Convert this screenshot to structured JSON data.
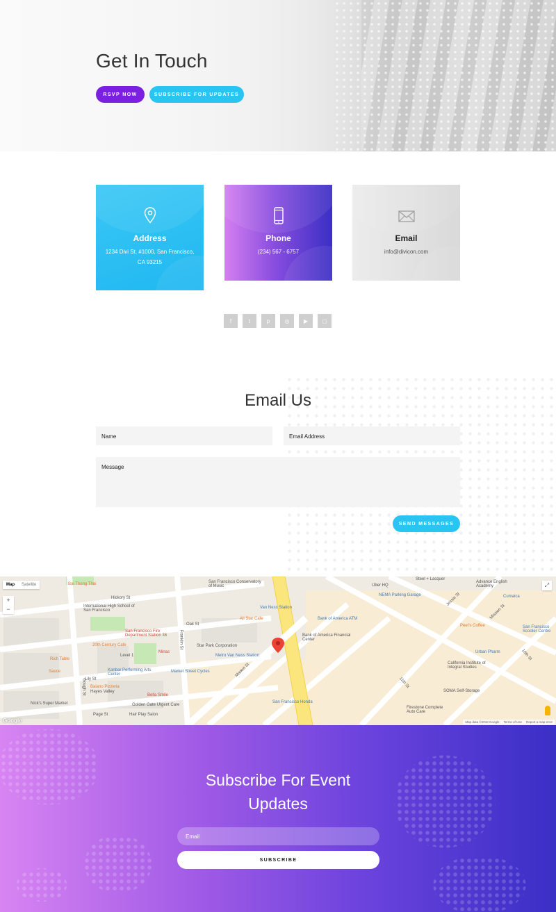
{
  "hero": {
    "title": "Get In Touch",
    "rsvp_label": "RSVP NOW",
    "subscribe_label": "SUBSCRIBE FOR UPDATES"
  },
  "contact": {
    "address": {
      "title": "Address",
      "text": "1234 Divi St. #1000, San Francisco, CA 93215",
      "icon": "map-pin-icon"
    },
    "phone": {
      "title": "Phone",
      "text": "(234) 567 - 6757",
      "icon": "phone-icon"
    },
    "email": {
      "title": "Email",
      "text": "info@divicon.com",
      "icon": "envelope-icon"
    }
  },
  "social": [
    {
      "name": "facebook-icon",
      "glyph": "f"
    },
    {
      "name": "twitter-icon",
      "glyph": "t"
    },
    {
      "name": "pinterest-icon",
      "glyph": "p"
    },
    {
      "name": "dribbble-icon",
      "glyph": "◎"
    },
    {
      "name": "youtube-icon",
      "glyph": "▶"
    },
    {
      "name": "instagram-icon",
      "glyph": "◻"
    }
  ],
  "email_form": {
    "title": "Email Us",
    "name_placeholder": "Name",
    "email_placeholder": "Email Address",
    "message_placeholder": "Message",
    "submit_label": "SEND MESSAGES"
  },
  "map": {
    "type_map": "Map",
    "type_satellite": "Satellite",
    "zoom_in": "+",
    "zoom_out": "−",
    "labels": [
      "Bai Thong Thai",
      "San Francisco Conservatory of Music",
      "Uber HQ",
      "Steel + Lacquer",
      "Advance English Academy",
      "Hickory St",
      "NEMA Parking Garage",
      "Cumaica",
      "International High School of San Francisco",
      "Van Ness Station",
      "All Star Cafe",
      "Bank of America ATM",
      "Peet's Coffee",
      "Oak St",
      "Bank of America Financial Center",
      "San Francisco Fire Department Station 36",
      "20th Century Cafe",
      "Star Park Corporation",
      "Minas",
      "Level 1",
      "Metro Van Ness Station",
      "Urban Pharm",
      "Rich Table",
      "Sauce",
      "Kanbar Performing Arts Center",
      "Market Street Cycles",
      "California Institute of Integral Studies",
      "Lily St",
      "Baiano Pizzeria",
      "Hayes Valley",
      "SOMA Self-Storage",
      "Bella Smile",
      "Nick's Super Market",
      "Golden Gate Urgent Care",
      "San Francisco Honda",
      "Firestone Complete Auto Care",
      "Page St",
      "Hair Play Salon",
      "Market St",
      "Franklin St",
      "Gough St",
      "11th St",
      "10th St",
      "Mission St",
      "Jessie St",
      "San Francisco Scooter Centre"
    ],
    "footer": [
      "Map data ©2018 Google",
      "Terms of Use",
      "Report a map error"
    ],
    "logo": "Google"
  },
  "subscribe": {
    "title": "Subscribe For Event Updates",
    "email_placeholder": "Email",
    "button_label": "SUBSCRIBE"
  },
  "colors": {
    "accent_purple": "#7b1fe0",
    "accent_blue": "#29c4f1"
  }
}
